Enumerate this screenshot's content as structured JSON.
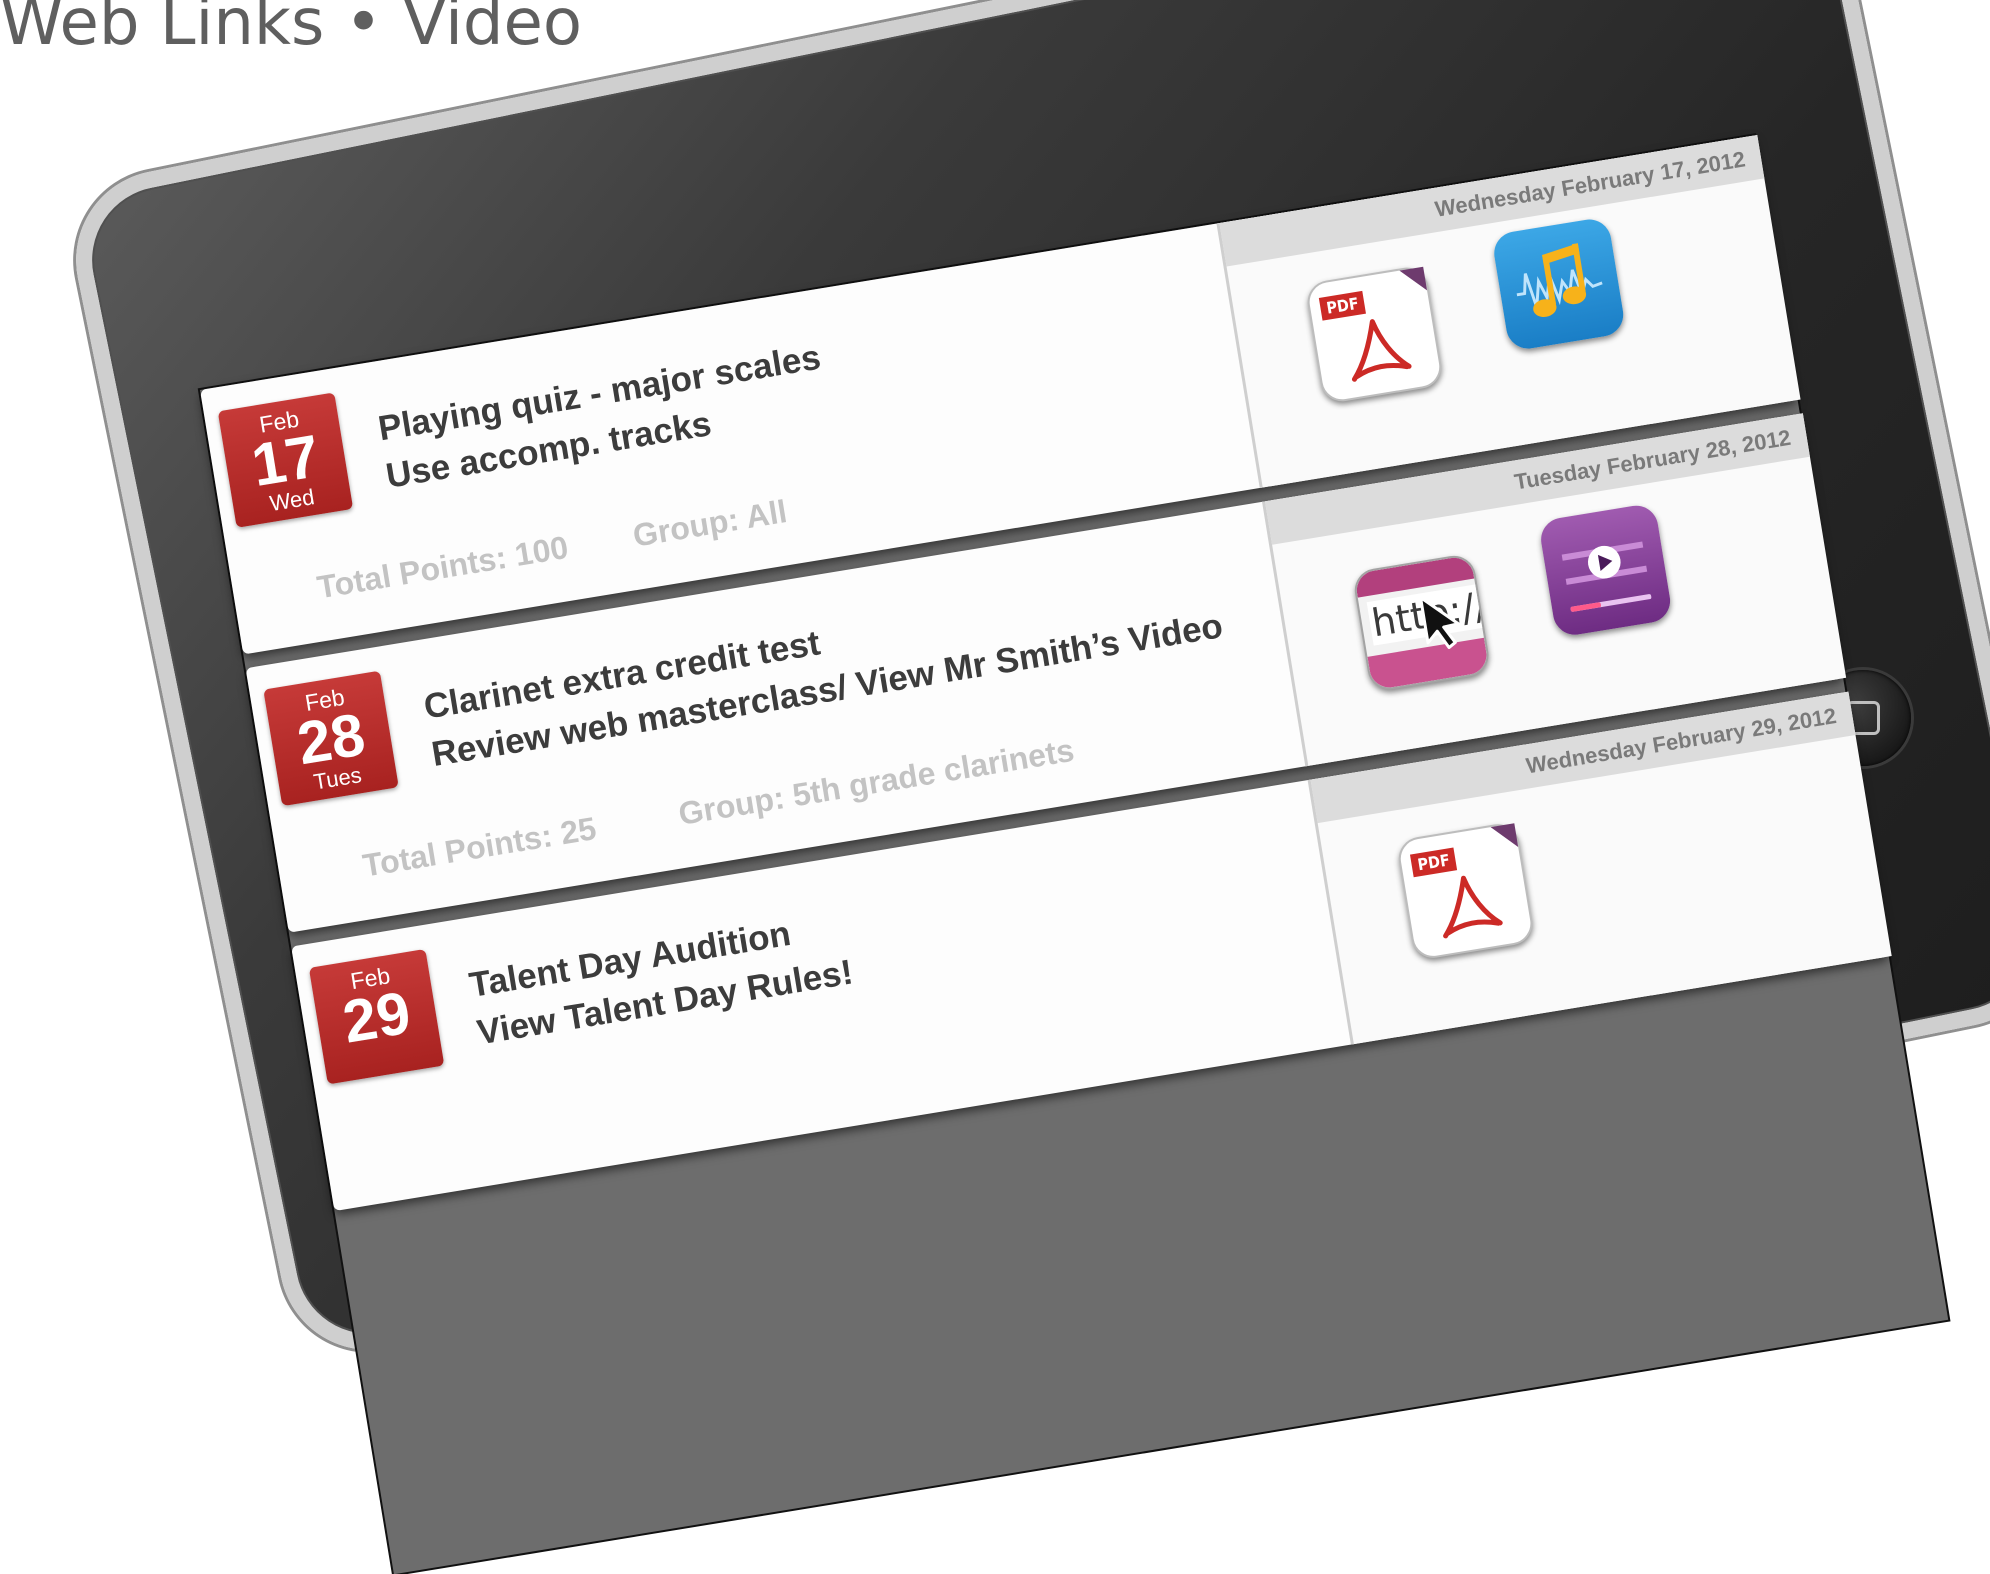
{
  "page": {
    "heading": "Web Links • Video"
  },
  "assignments": [
    {
      "month": "Feb",
      "day": "17",
      "weekday": "Wed",
      "title_line1": "Playing quiz - major scales",
      "title_line2": "Use accomp. tracks",
      "points": "Total Points: 100",
      "group": "Group: All",
      "panel_date": "Wednesday February 17, 2012",
      "icons": [
        "pdf-icon",
        "music-icon"
      ]
    },
    {
      "month": "Feb",
      "day": "28",
      "weekday": "Tues",
      "title_line1": "Clarinet extra credit test",
      "title_line2": "Review web masterclass/ View Mr Smith’s Video",
      "points": "Total Points: 25",
      "group": "Group: 5th grade clarinets",
      "panel_date": "Tuesday February 28, 2012",
      "icons": [
        "web-link-icon",
        "video-icon"
      ],
      "link_label": "http://"
    },
    {
      "month": "Feb",
      "day": "29",
      "weekday": "",
      "title_line1": "Talent Day Audition",
      "title_line2": "View Talent Day Rules!",
      "points": "",
      "group": "",
      "panel_date": "Wednesday February 29, 2012",
      "icons": [
        "pdf-icon"
      ]
    }
  ],
  "icon_labels": {
    "pdf": "PDF"
  },
  "colors": {
    "badge_red": "#b3292a",
    "pdf_red": "#cc2a26",
    "music_blue": "#1a7ec6",
    "music_gold": "#f7b21a",
    "link_pink": "#c9528f",
    "video_purple": "#6e2c83"
  }
}
